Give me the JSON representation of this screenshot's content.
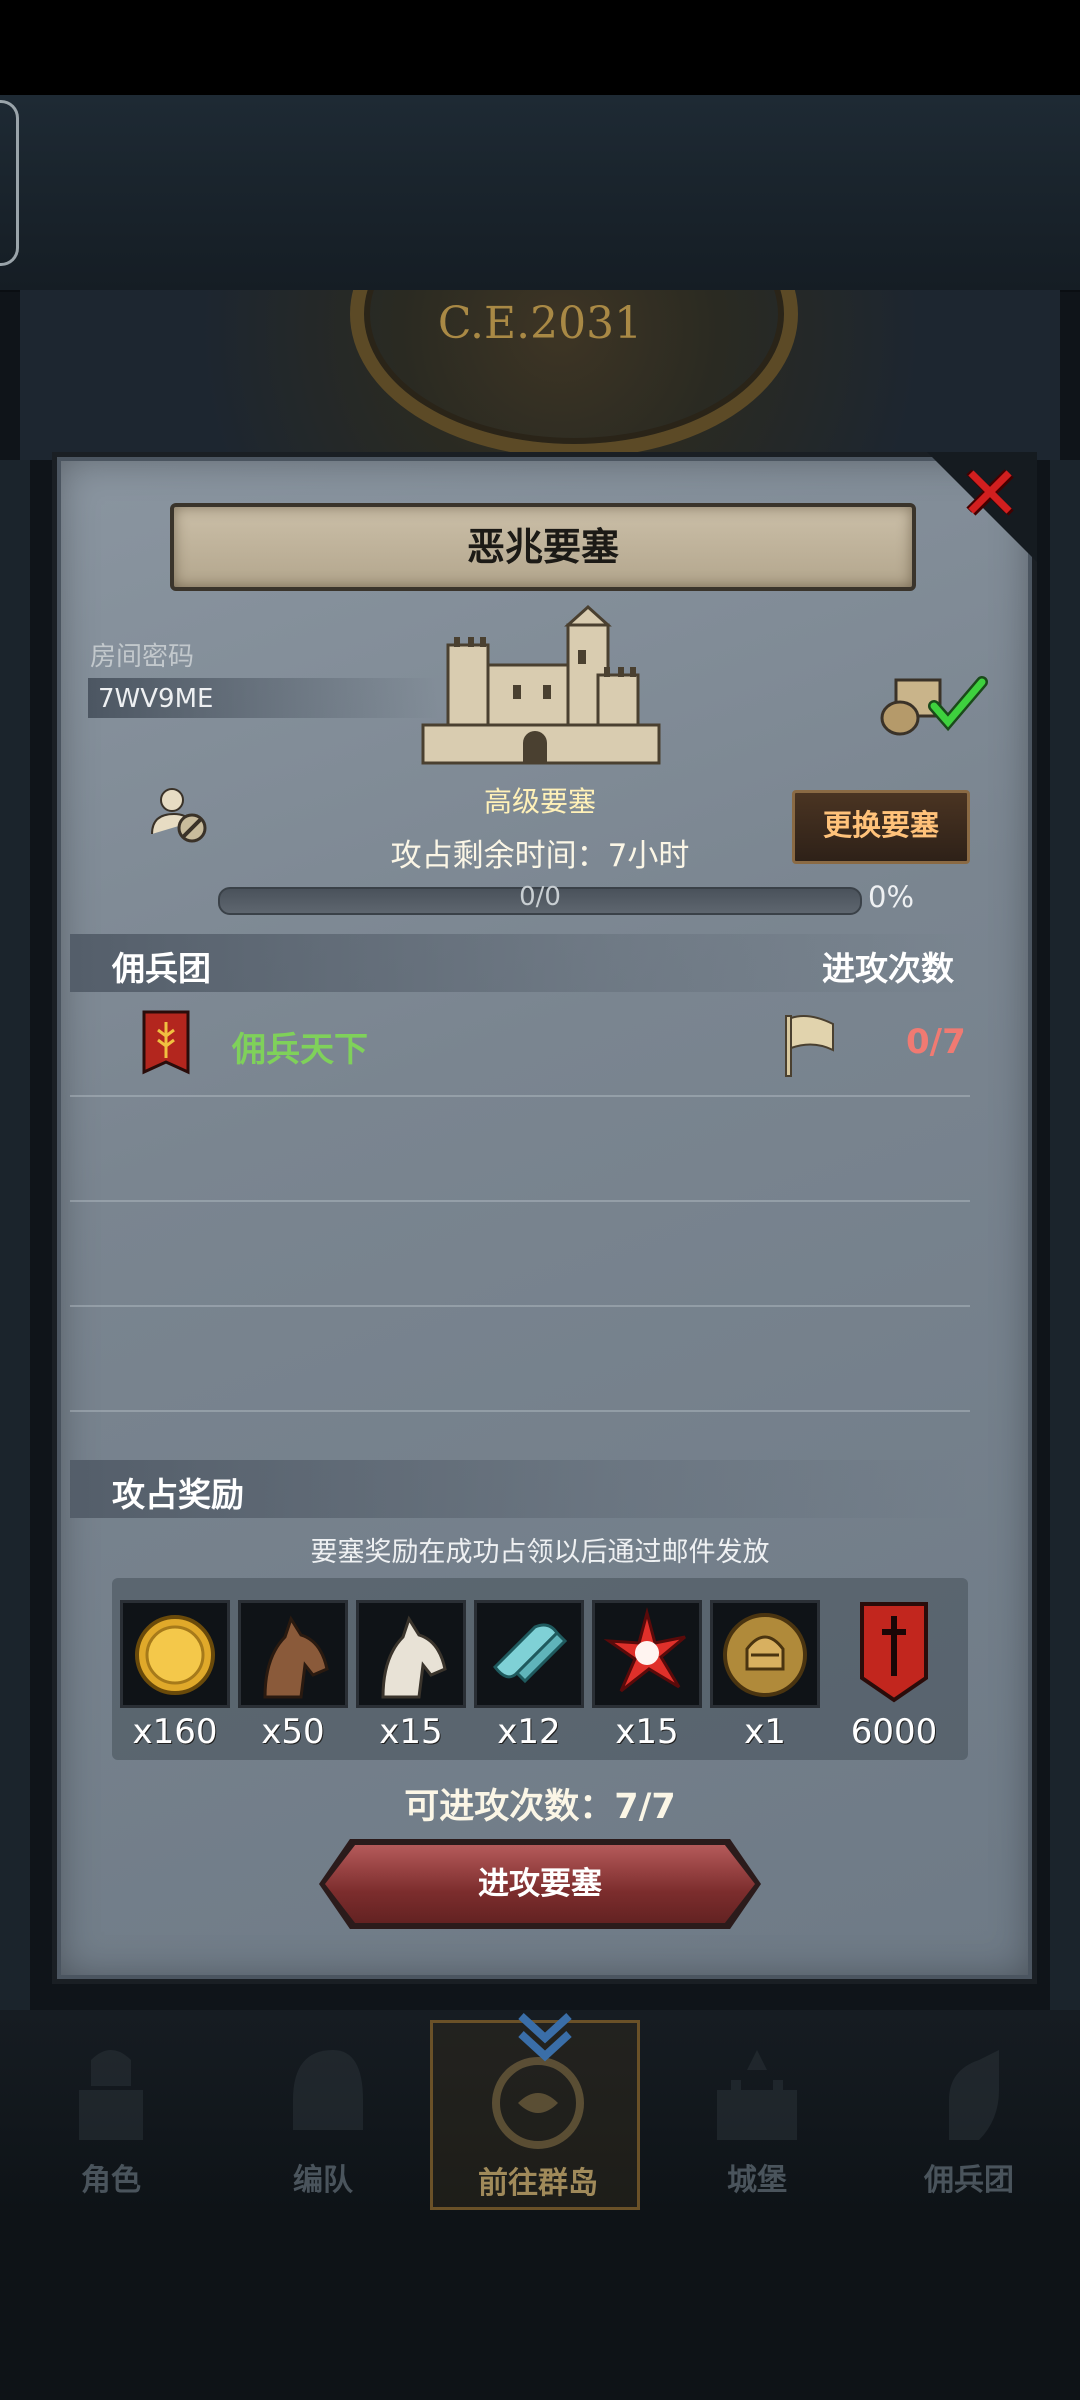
{
  "era": {
    "label": "C.E.2031"
  },
  "dialog": {
    "title": "恶兆要塞",
    "close_icon": "close-x-icon",
    "room": {
      "label": "房间密码",
      "code": "7WV9ME"
    },
    "fortress": {
      "level_label": "高级要塞",
      "icon": "fortress-castle-icon"
    },
    "timer": {
      "label": "攻占剩余时间：7小时"
    },
    "progress": {
      "text": "0/0",
      "percent_label": "0%",
      "fraction": 0
    },
    "change_button": "更换要塞",
    "guild_section": {
      "title": "佣兵团",
      "count_header": "进攻次数",
      "rows": [
        {
          "name": "佣兵天下",
          "count": "0/7",
          "icon": "guild-banner-icon",
          "flag_icon": "flag-icon"
        }
      ]
    },
    "reward_section": {
      "title": "攻占奖励",
      "note": "要塞奖励在成功占领以后通过邮件发放",
      "items": [
        {
          "icon": "gold-coin-icon",
          "qty": "x160"
        },
        {
          "icon": "brown-horse-icon",
          "qty": "x50"
        },
        {
          "icon": "white-horse-icon",
          "qty": "x15"
        },
        {
          "icon": "cloth-scroll-icon",
          "qty": "x12"
        },
        {
          "icon": "red-star-crystal-icon",
          "qty": "x15"
        },
        {
          "icon": "knight-helmet-medal-icon",
          "qty": "x1"
        },
        {
          "icon": "red-sword-banner-icon",
          "qty": "6000"
        }
      ]
    },
    "attacks_left": "可进攻次数：7/7",
    "attack_button": "进攻要塞"
  },
  "nav": {
    "items": [
      {
        "label": "角色",
        "icon": "knight-armor-icon",
        "active": false
      },
      {
        "label": "编队",
        "icon": "helmet-formation-icon",
        "active": false
      },
      {
        "label": "前往群岛",
        "icon": "world-map-compass-icon",
        "active": true
      },
      {
        "label": "城堡",
        "icon": "castle-icon",
        "active": false
      },
      {
        "label": "佣兵团",
        "icon": "mercenary-icon",
        "active": false
      }
    ]
  },
  "colors": {
    "guild_name": "#7fd15a",
    "attack_count": "#f07a72",
    "change_button_text": "#ffc27a",
    "close_icon": "#d11f1f"
  }
}
